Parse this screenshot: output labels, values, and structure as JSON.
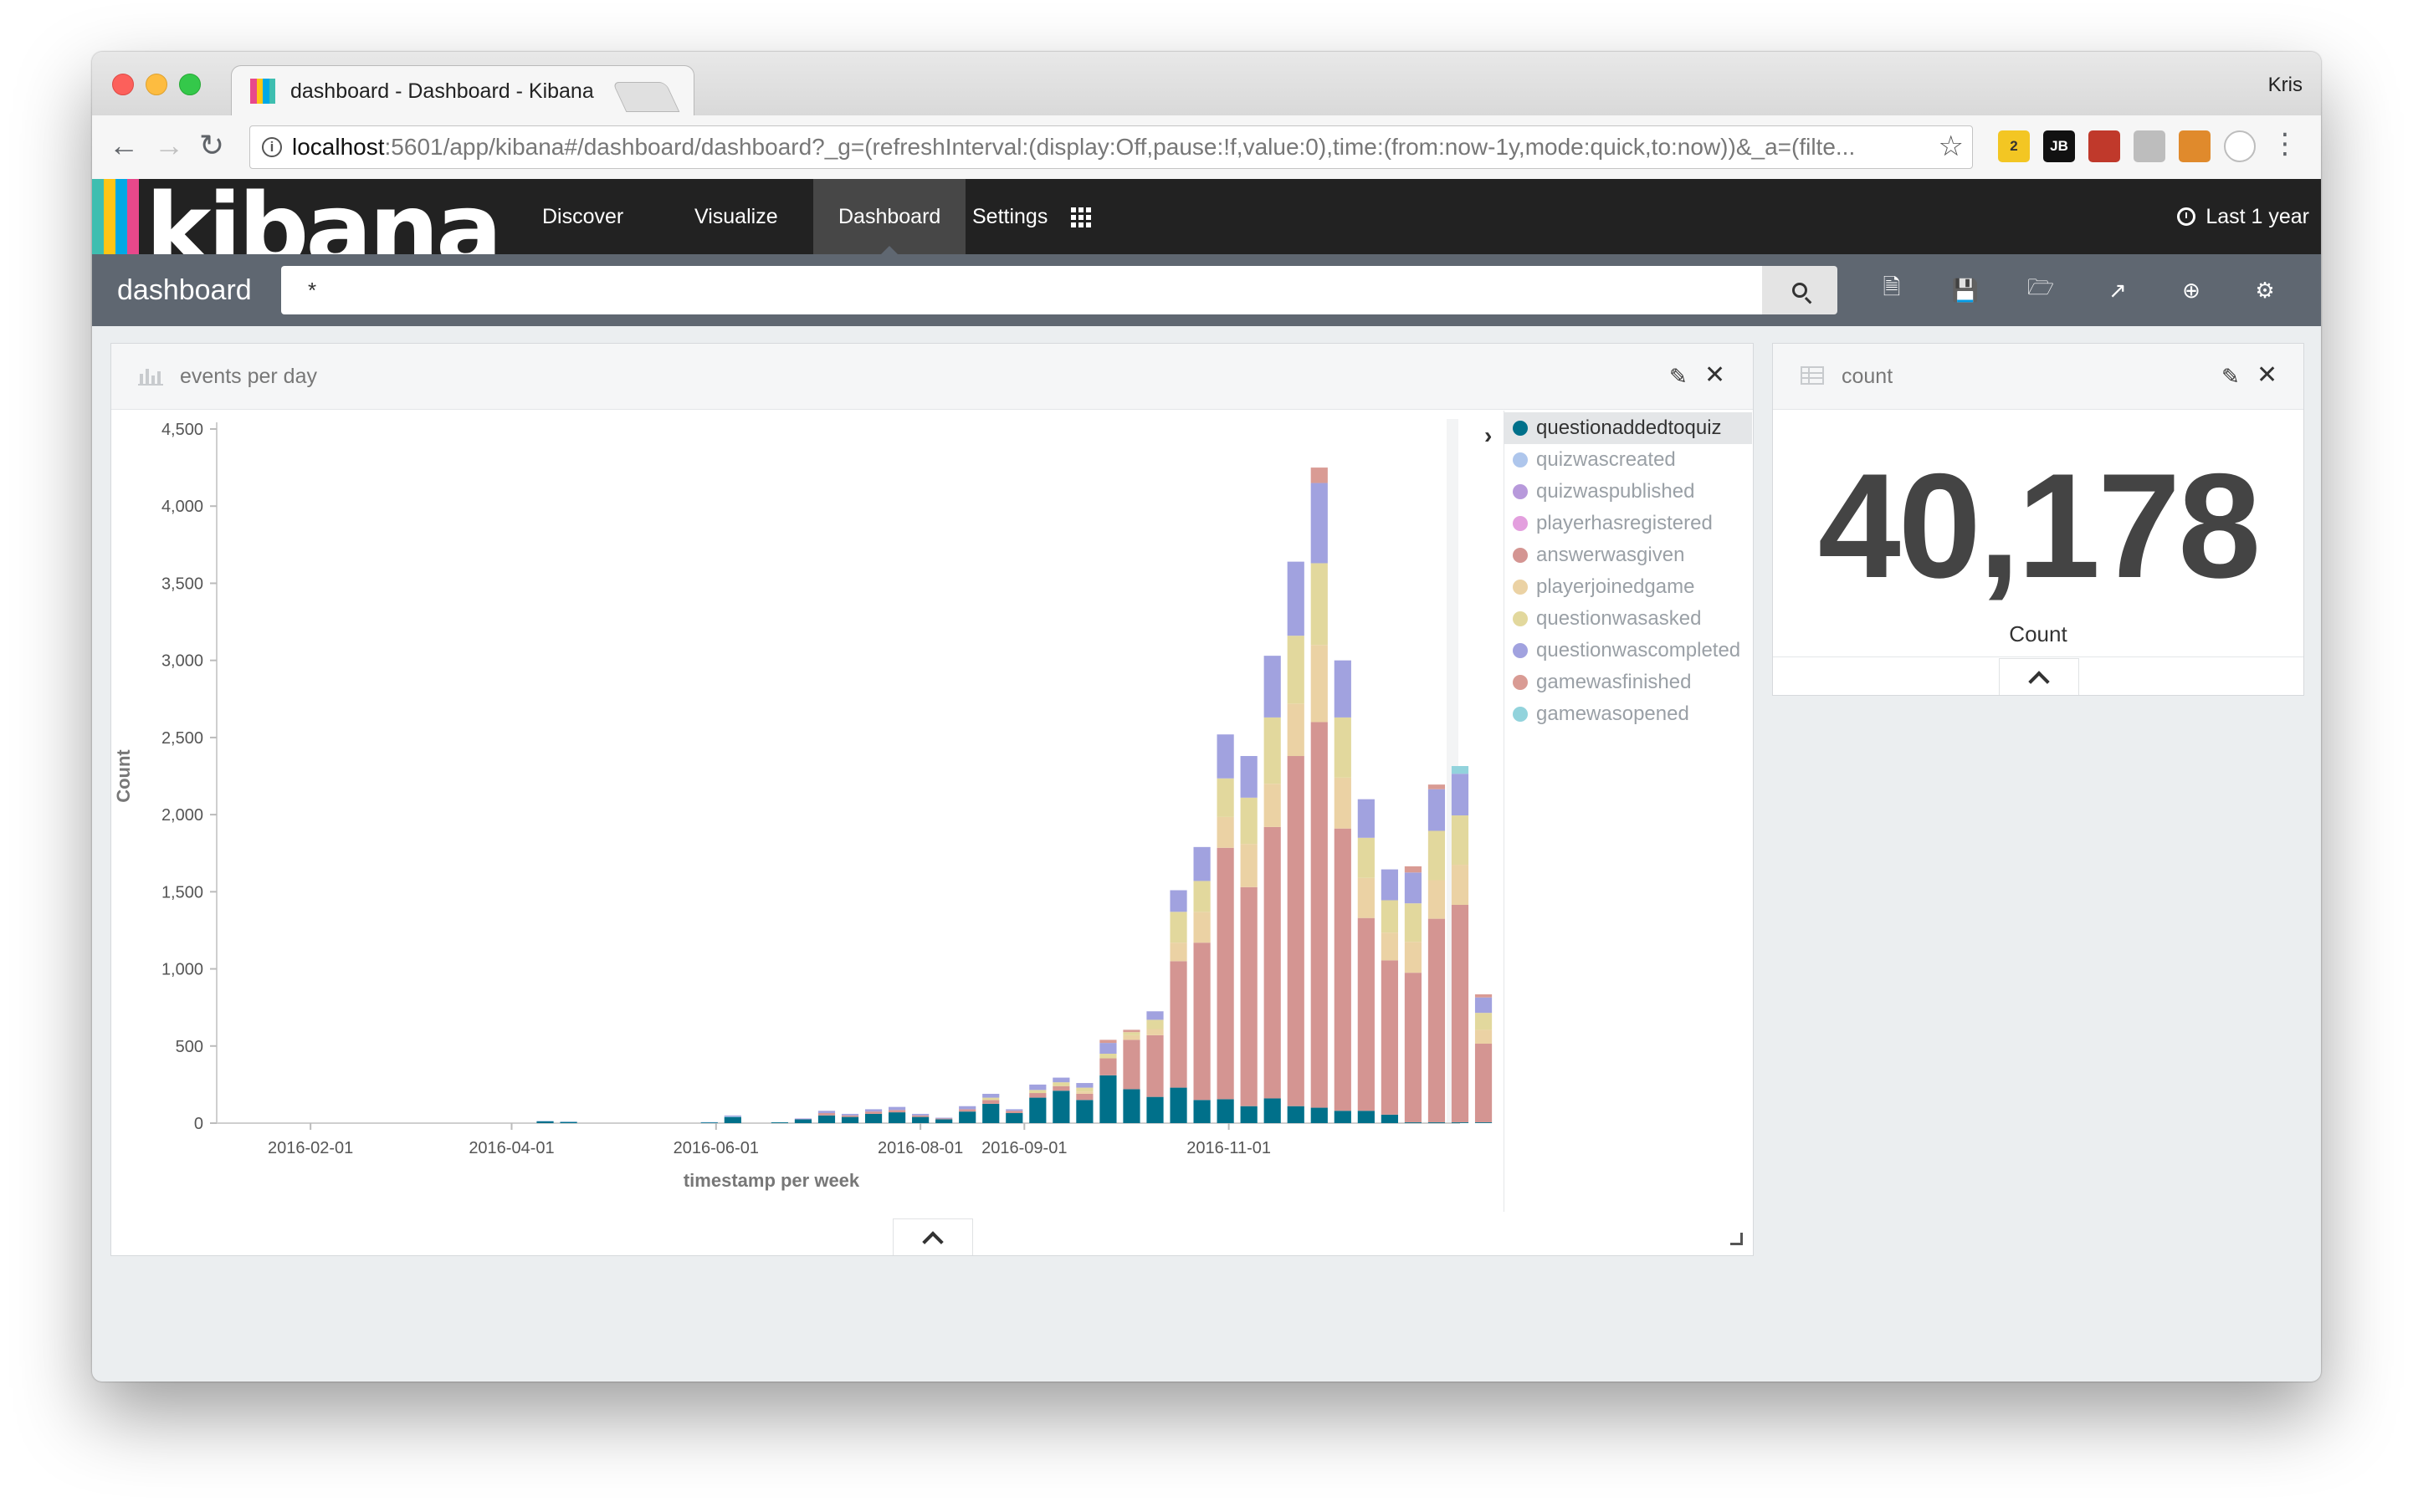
{
  "browser": {
    "tab_title": "dashboard - Dashboard - Kibana",
    "close_glyph": "×",
    "profile_name": "Kris",
    "url_host": "localhost",
    "url_rest": ":5601/app/kibana#/dashboard/dashboard?_g=(refreshInterval:(display:Off,pause:!f,value:0),time:(from:now-1y,mode:quick,to:now))&_a=(filte...",
    "icons": [
      "back-arrow-icon",
      "forward-arrow-icon",
      "reload-icon",
      "info-icon",
      "star-icon",
      "menu-icon"
    ],
    "extensions": [
      {
        "name": "extension-badge-2-icon",
        "label": "2",
        "color": "#f3c623"
      },
      {
        "name": "extension-jb-icon",
        "label": "JB",
        "color": "#111111"
      },
      {
        "name": "extension-calendar-icon",
        "label": "",
        "color": "#c0392b"
      },
      {
        "name": "extension-drive-icon",
        "label": "",
        "color": "#bdbdbd"
      },
      {
        "name": "extension-basket-icon",
        "label": "",
        "color": "#e08a2c"
      },
      {
        "name": "extension-circle-icon",
        "label": "",
        "color": "#bdbdbd"
      }
    ]
  },
  "kibana": {
    "logo_text": "kibana",
    "logo_colors": [
      "#e8488b",
      "#00a9e5",
      "#fec514",
      "#3ebeb0"
    ],
    "nav": [
      "Discover",
      "Visualize",
      "Dashboard",
      "Settings"
    ],
    "active_nav": "Dashboard",
    "time_range": "Last 1 year"
  },
  "querybar": {
    "dashboard_title": "dashboard",
    "query": "*",
    "icons": [
      "new-dashboard-icon",
      "save-icon",
      "open-icon",
      "share-icon",
      "add-panel-icon",
      "options-gear-icon"
    ]
  },
  "panels": {
    "events": {
      "title": "events per day"
    },
    "count": {
      "title": "count",
      "value": "40,178",
      "label": "Count"
    }
  },
  "colors": {
    "questionaddedtoquiz": "#00708a",
    "quizwascreated": "#aec6ec",
    "quizwaspublished": "#b799db",
    "playerhasregistered": "#e39fde",
    "answerwasgiven": "#d49592",
    "playerjoinedgame": "#ebd2a4",
    "questionwasasked": "#e2d89d",
    "questionwascompleted": "#a1a2df",
    "gamewasfinished": "#d99b94",
    "gamewasopened": "#92d3dc"
  },
  "chart_data": {
    "type": "bar",
    "stacked": true,
    "xlabel": "timestamp per week",
    "ylabel": "Count",
    "ylim": [
      0,
      4500
    ],
    "yticks": [
      0,
      500,
      1000,
      1500,
      2000,
      2500,
      3000,
      3500,
      4000,
      4500
    ],
    "ytick_labels": [
      "0",
      "500",
      "1,000",
      "1,500",
      "2,000",
      "2,500",
      "3,000",
      "3,500",
      "4,000",
      "4,500"
    ],
    "xlim": [
      "2016-01-04",
      "2017-01-09"
    ],
    "xticks": [
      "2016-02-01",
      "2016-04-01",
      "2016-06-01",
      "2016-08-01",
      "2016-09-01",
      "2016-11-01"
    ],
    "legend_position": "right",
    "grid": false,
    "legend": [
      "questionaddedtoquiz",
      "quizwascreated",
      "quizwaspublished",
      "playerhasregistered",
      "answerwasgiven",
      "playerjoinedgame",
      "questionwasasked",
      "questionwascompleted",
      "gamewasfinished",
      "gamewasopened"
    ],
    "weeks": [
      {
        "week": "2016-04-11",
        "values": {
          "questionaddedtoquiz": 12,
          "quizwascreated": 3
        }
      },
      {
        "week": "2016-04-18",
        "values": {
          "questionaddedtoquiz": 8,
          "quizwascreated": 2
        }
      },
      {
        "week": "2016-05-30",
        "values": {
          "questionaddedtoquiz": 5,
          "quizwascreated": 2
        }
      },
      {
        "week": "2016-06-06",
        "values": {
          "questionaddedtoquiz": 40,
          "quizwascreated": 5,
          "questionwascompleted": 5
        }
      },
      {
        "week": "2016-06-20",
        "values": {
          "questionaddedtoquiz": 5
        }
      },
      {
        "week": "2016-06-27",
        "values": {
          "questionaddedtoquiz": 25,
          "quizwaspublished": 5
        }
      },
      {
        "week": "2016-07-04",
        "values": {
          "questionaddedtoquiz": 50,
          "answerwasgiven": 15,
          "questionwascompleted": 15
        }
      },
      {
        "week": "2016-07-11",
        "values": {
          "questionaddedtoquiz": 40,
          "answerwasgiven": 10,
          "questionwascompleted": 10
        }
      },
      {
        "week": "2016-07-18",
        "values": {
          "questionaddedtoquiz": 60,
          "answerwasgiven": 15,
          "questionwascompleted": 15
        }
      },
      {
        "week": "2016-07-25",
        "values": {
          "questionaddedtoquiz": 70,
          "answerwasgiven": 15,
          "questionwascompleted": 20
        }
      },
      {
        "week": "2016-08-01",
        "values": {
          "questionaddedtoquiz": 40,
          "answerwasgiven": 10,
          "questionwascompleted": 10
        }
      },
      {
        "week": "2016-08-08",
        "values": {
          "questionaddedtoquiz": 25,
          "answerwasgiven": 5,
          "questionwascompleted": 5
        }
      },
      {
        "week": "2016-08-15",
        "values": {
          "questionaddedtoquiz": 75,
          "answerwasgiven": 15,
          "questionwascompleted": 20
        }
      },
      {
        "week": "2016-08-22",
        "values": {
          "questionaddedtoquiz": 125,
          "answerwasgiven": 25,
          "questionwasasked": 15,
          "questionwascompleted": 25
        }
      },
      {
        "week": "2016-08-29",
        "values": {
          "questionaddedtoquiz": 65,
          "answerwasgiven": 15,
          "questionwascompleted": 10
        }
      },
      {
        "week": "2016-09-05",
        "values": {
          "questionaddedtoquiz": 165,
          "answerwasgiven": 30,
          "questionwasasked": 20,
          "questionwascompleted": 35
        }
      },
      {
        "week": "2016-09-12",
        "values": {
          "questionaddedtoquiz": 210,
          "answerwasgiven": 30,
          "questionwasasked": 25,
          "questionwascompleted": 30
        }
      },
      {
        "week": "2016-09-19",
        "values": {
          "questionaddedtoquiz": 150,
          "answerwasgiven": 40,
          "playerjoinedgame": 15,
          "questionwasasked": 25,
          "questionwascompleted": 30
        }
      },
      {
        "week": "2016-09-26",
        "values": {
          "questionaddedtoquiz": 310,
          "answerwasgiven": 110,
          "questionwasasked": 30,
          "questionwascompleted": 70,
          "gamewasfinished": 20
        }
      },
      {
        "week": "2016-10-03",
        "values": {
          "questionaddedtoquiz": 220,
          "answerwasgiven": 320,
          "playerjoinedgame": 30,
          "questionwasasked": 20,
          "gamewasfinished": 15
        }
      },
      {
        "week": "2016-10-10",
        "values": {
          "questionaddedtoquiz": 170,
          "answerwasgiven": 400,
          "playerjoinedgame": 40,
          "questionwasasked": 60,
          "questionwascompleted": 55
        }
      },
      {
        "week": "2016-10-17",
        "values": {
          "questionaddedtoquiz": 230,
          "answerwasgiven": 820,
          "playerjoinedgame": 120,
          "questionwasasked": 200,
          "questionwascompleted": 140
        }
      },
      {
        "week": "2016-10-24",
        "values": {
          "questionaddedtoquiz": 150,
          "answerwasgiven": 1020,
          "playerjoinedgame": 200,
          "questionwasasked": 200,
          "questionwascompleted": 220
        }
      },
      {
        "week": "2016-10-31",
        "values": {
          "questionaddedtoquiz": 155,
          "answerwasgiven": 1630,
          "playerjoinedgame": 200,
          "questionwasasked": 250,
          "questionwascompleted": 285
        }
      },
      {
        "week": "2016-11-07",
        "values": {
          "questionaddedtoquiz": 110,
          "answerwasgiven": 1420,
          "playerjoinedgame": 280,
          "questionwasasked": 300,
          "questionwascompleted": 270
        }
      },
      {
        "week": "2016-11-14",
        "values": {
          "questionaddedtoquiz": 160,
          "answerwasgiven": 1760,
          "playerjoinedgame": 280,
          "questionwasasked": 430,
          "questionwascompleted": 400
        }
      },
      {
        "week": "2016-11-21",
        "values": {
          "questionaddedtoquiz": 110,
          "answerwasgiven": 2270,
          "playerjoinedgame": 340,
          "questionwasasked": 440,
          "questionwascompleted": 480
        }
      },
      {
        "week": "2016-11-28",
        "values": {
          "questionaddedtoquiz": 100,
          "answerwasgiven": 2500,
          "playerjoinedgame": 500,
          "questionwasasked": 530,
          "questionwascompleted": 520,
          "gamewasfinished": 100
        }
      },
      {
        "week": "2016-12-05",
        "values": {
          "questionaddedtoquiz": 80,
          "answerwasgiven": 1830,
          "playerjoinedgame": 330,
          "questionwasasked": 390,
          "questionwascompleted": 370
        }
      },
      {
        "week": "2016-12-12",
        "values": {
          "questionaddedtoquiz": 80,
          "answerwasgiven": 1250,
          "playerjoinedgame": 260,
          "questionwasasked": 260,
          "questionwascompleted": 250
        }
      },
      {
        "week": "2016-12-19",
        "values": {
          "questionaddedtoquiz": 55,
          "answerwasgiven": 1000,
          "playerjoinedgame": 180,
          "questionwasasked": 210,
          "questionwascompleted": 200
        }
      },
      {
        "week": "2016-12-26",
        "values": {
          "questionaddedtoquiz": 5,
          "answerwasgiven": 970,
          "playerjoinedgame": 200,
          "questionwasasked": 250,
          "questionwascompleted": 200,
          "gamewasfinished": 40
        }
      },
      {
        "week": "2017-01-02",
        "values": {
          "questionaddedtoquiz": 5,
          "answerwasgiven": 1320,
          "playerjoinedgame": 250,
          "questionwasasked": 320,
          "questionwascompleted": 270,
          "gamewasfinished": 30
        }
      },
      {
        "week": "2017-01-09",
        "values": {
          "questionaddedtoquiz": 5,
          "answerwasgiven": 1410,
          "playerjoinedgame": 260,
          "questionwasasked": 320,
          "questionwascompleted": 270,
          "gamewasopened": 50
        }
      },
      {
        "week": "2017-01-16",
        "values": {
          "questionaddedtoquiz": 5,
          "answerwasgiven": 510,
          "playerjoinedgame": 90,
          "questionwasasked": 110,
          "questionwascompleted": 100,
          "gamewasfinished": 20
        }
      }
    ]
  }
}
